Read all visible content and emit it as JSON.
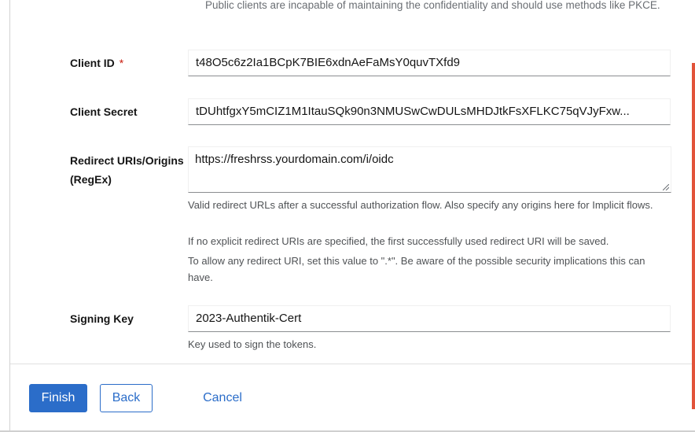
{
  "intro": {
    "text": "Public clients are incapable of maintaining the confidentiality and should use methods like PKCE."
  },
  "client_id": {
    "label": "Client ID",
    "required_marker": "*",
    "value": "t48O5c6z2Ia1BCpK7BIE6xdnAeFaMsY0quvTXfd9"
  },
  "client_secret": {
    "label": "Client Secret",
    "value": "tDUhtfgxY5mCIZ1M1ItauSQk90n3NMUSwCwDULsMHDJtkFsXFLKC75qVJyFxw..."
  },
  "redirect_uris": {
    "label_line1": "Redirect URIs/Origins",
    "label_line2": "(RegEx)",
    "value": "https://freshrss.yourdomain.com/i/oidc",
    "help1": "Valid redirect URLs after a successful authorization flow. Also specify any origins here for Implicit flows.",
    "help2": "If no explicit redirect URIs are specified, the first successfully used redirect URI will be saved.",
    "help3": "To allow any redirect URI, set this value to \".*\". Be aware of the possible security implications this can have."
  },
  "signing_key": {
    "label": "Signing Key",
    "value": "2023-Authentik-Cert",
    "help": "Key used to sign the tokens."
  },
  "footer": {
    "finish_label": "Finish",
    "back_label": "Back",
    "cancel_label": "Cancel"
  },
  "colors": {
    "primary": "#2b6dc9",
    "required": "#c9190b",
    "scrollbar": "#e2533a"
  }
}
